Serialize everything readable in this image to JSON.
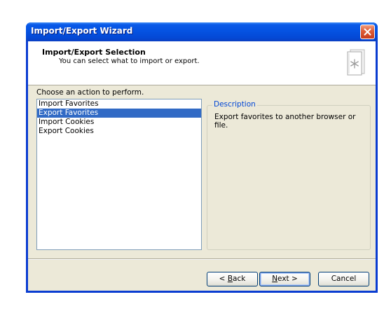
{
  "window": {
    "title": "Import/Export Wizard"
  },
  "header": {
    "title": "Import/Export Selection",
    "subtitle": "You can select what to import or export.",
    "icon": "wizard-document-icon"
  },
  "main": {
    "choose_label": "Choose an action to perform.",
    "actions": [
      "Import Favorites",
      "Export Favorites",
      "Import Cookies",
      "Export Cookies"
    ],
    "selected_index": 1,
    "description_label": "Description",
    "description_text": "Export favorites to another browser or file."
  },
  "buttons": {
    "back": {
      "pre": "< ",
      "mnemonic": "B",
      "post": "ack"
    },
    "next": {
      "pre": "",
      "mnemonic": "N",
      "post": "ext >"
    },
    "cancel": "Cancel"
  },
  "colors": {
    "titlebar": "#0554e3",
    "selection": "#316ac5",
    "dialog_face": "#ece9d8",
    "group_label": "#0046d5",
    "close_button": "#e0603a"
  }
}
